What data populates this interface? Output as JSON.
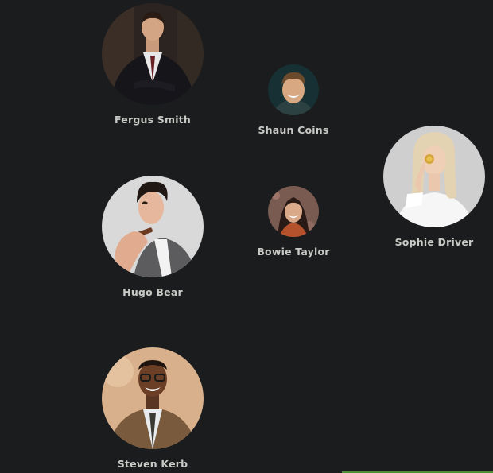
{
  "people": [
    {
      "name": "Fergus Smith"
    },
    {
      "name": "Shaun Coins"
    },
    {
      "name": "Sophie Driver"
    },
    {
      "name": "Hugo Bear"
    },
    {
      "name": "Bowie Taylor"
    },
    {
      "name": "Steven Kerb"
    }
  ],
  "colors": {
    "background": "#1b1c1e",
    "name_text": "#c9c9c6",
    "accent_line": "#4f8f3a"
  }
}
